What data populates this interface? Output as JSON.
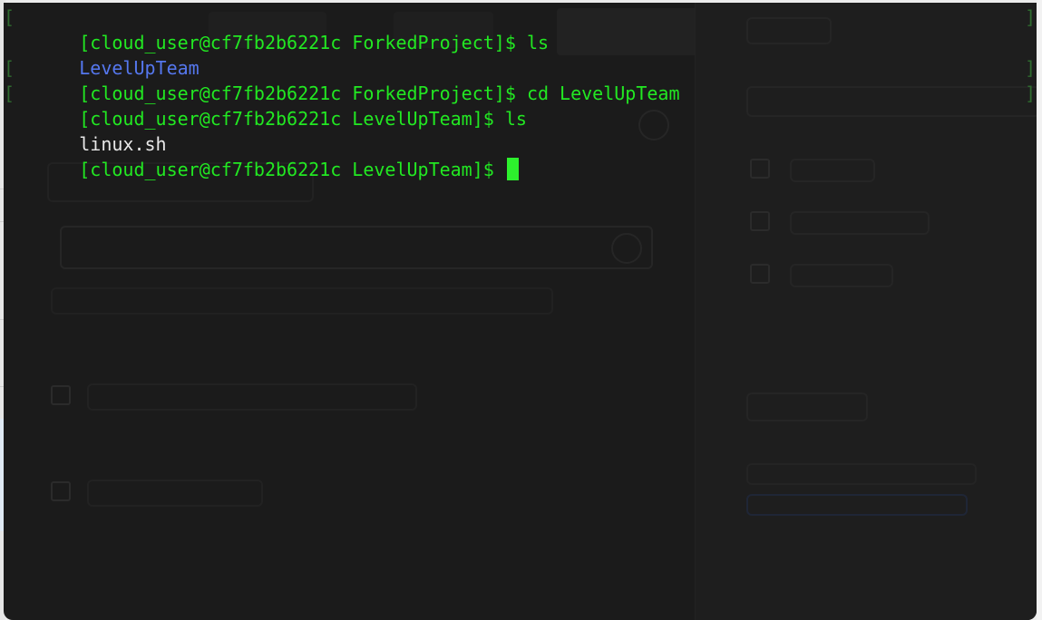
{
  "terminal": {
    "lines": [
      {
        "type": "prompt",
        "prompt": "[cloud_user@cf7fb2b6221c ForkedProject]$ ",
        "command": "ls",
        "left_bracket": "[",
        "right_bracket": "]"
      },
      {
        "type": "output-dir",
        "text": "LevelUpTeam"
      },
      {
        "type": "prompt",
        "prompt": "[cloud_user@cf7fb2b6221c ForkedProject]$ ",
        "command": "cd LevelUpTeam",
        "left_bracket": "[",
        "right_bracket": "]"
      },
      {
        "type": "prompt",
        "prompt": "[cloud_user@cf7fb2b6221c LevelUpTeam]$ ",
        "command": "ls",
        "left_bracket": "[",
        "right_bracket": "]"
      },
      {
        "type": "output-file",
        "text": "linux.sh"
      },
      {
        "type": "prompt-active",
        "prompt": "[cloud_user@cf7fb2b6221c LevelUpTeam]$ ",
        "command": ""
      }
    ],
    "colors": {
      "background": "#1b1b1b",
      "prompt": "#22e822",
      "directory": "#5577ee",
      "file": "#e8e8e8",
      "cursor": "#2df02d"
    }
  }
}
